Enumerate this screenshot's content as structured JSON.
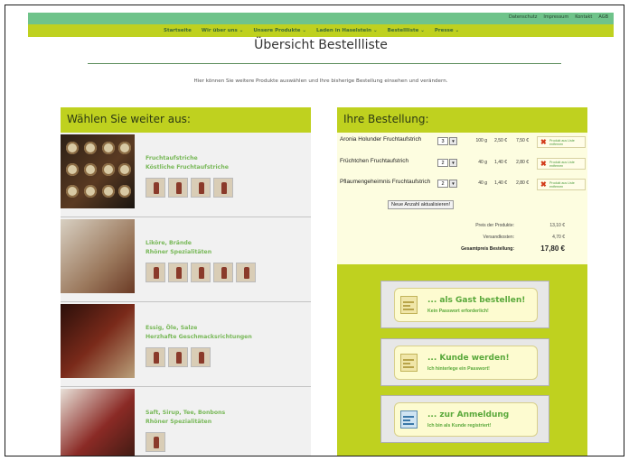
{
  "topbar": {
    "links": [
      "Datenschutz",
      "Impressum",
      "Kontakt",
      "AGB"
    ]
  },
  "nav": {
    "items": [
      "Startseite",
      "Wir über uns ⌄",
      "Unsere Produkte ⌄",
      "Laden in Haselstein ⌄",
      "Bestellliste ⌄",
      "Presse ⌄"
    ]
  },
  "page": {
    "title": "Übersicht Bestellliste",
    "intro": "Hier können Sie weitere Produkte auswählen und Ihre bisherige Bestellung einsehen und verändern."
  },
  "left": {
    "heading": "Wählen Sie weiter aus:",
    "products": [
      {
        "name": "Fruchtaufstriche",
        "sub": "Köstliche Fruchtaufstriche",
        "thumbs": 4
      },
      {
        "name": "Liköre, Brände",
        "sub": "Rhöner Spezialitäten",
        "thumbs": 5
      },
      {
        "name": "Essig, Öle, Salze",
        "sub": "Herzhafte Geschmacksrichtungen",
        "thumbs": 3
      },
      {
        "name": "Saft, Sirup, Tee, Bonbons",
        "sub": "Rhöner Spezialitäten",
        "thumbs": 1
      }
    ]
  },
  "right": {
    "heading": "Ihre Bestellung:",
    "rows": [
      {
        "name": "Aronia Holunder Fruchtaufstrich",
        "qty": "3",
        "weight": "100 g",
        "price": "2,50 €",
        "total": "7,50 €"
      },
      {
        "name": "Früchtchen Fruchtaufstrich",
        "qty": "2",
        "weight": "40 g",
        "price": "1,40 €",
        "total": "2,80 €"
      },
      {
        "name": "Pflaumengeheimnis Fruchtaufstrich",
        "qty": "2",
        "weight": "40 g",
        "price": "1,40 €",
        "total": "2,80 €"
      }
    ],
    "remove_label": "Produkt aus Liste entfernen",
    "update_label": "Neue Anzahl aktualisieren!",
    "summary": {
      "products_label": "Preis der Produkte:",
      "products_value": "13,10 €",
      "shipping_label": "Versandkosten:",
      "shipping_value": "4,70 €",
      "total_label": "Gesamtpreis Bestellung:",
      "total_value": "17,80 €"
    },
    "cta": [
      {
        "title": "... als Gast bestellen!",
        "sub": "Kein Passwort erforderlich!"
      },
      {
        "title": "... Kunde werden!",
        "sub": "Ich hinterlege ein Passwort!"
      },
      {
        "title": "... zur Anmeldung",
        "sub": "Ich bin als Kunde registriert!"
      }
    ]
  }
}
